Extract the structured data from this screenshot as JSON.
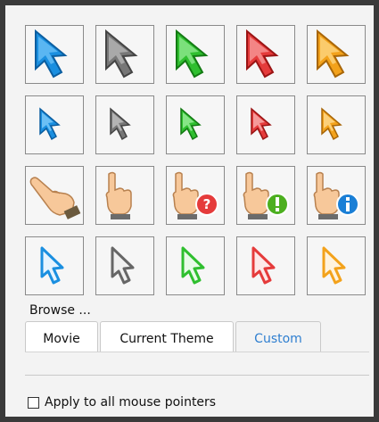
{
  "pointer_grid": {
    "rows": [
      [
        "pointer-arrow-large-blue-icon",
        "pointer-arrow-large-gray-icon",
        "pointer-arrow-large-green-icon",
        "pointer-arrow-large-red-icon",
        "pointer-arrow-large-orange-icon"
      ],
      [
        "pointer-arrow-small-blue-icon",
        "pointer-arrow-small-gray-icon",
        "pointer-arrow-small-green-icon",
        "pointer-arrow-small-red-icon",
        "pointer-arrow-small-orange-icon"
      ],
      [
        "pointer-hand-point-icon",
        "pointer-hand-up-icon",
        "pointer-hand-help-icon",
        "pointer-hand-warning-icon",
        "pointer-hand-info-icon"
      ],
      [
        "pointer-outline-blue-icon",
        "pointer-outline-gray-icon",
        "pointer-outline-green-icon",
        "pointer-outline-red-icon",
        "pointer-outline-orange-icon"
      ]
    ],
    "colors": {
      "blue": "#1a8fe0",
      "gray": "#777777",
      "green": "#2fbf2f",
      "red": "#e53b3b",
      "orange": "#f3a21b"
    }
  },
  "browse_label": "Browse ...",
  "tabs": [
    {
      "label": "Movie"
    },
    {
      "label": "Current Theme"
    },
    {
      "label": "Custom",
      "active": true
    }
  ],
  "accent_color": "#2f7fd0",
  "apply_all": {
    "label": "Apply to all mouse pointers",
    "checked": false
  }
}
